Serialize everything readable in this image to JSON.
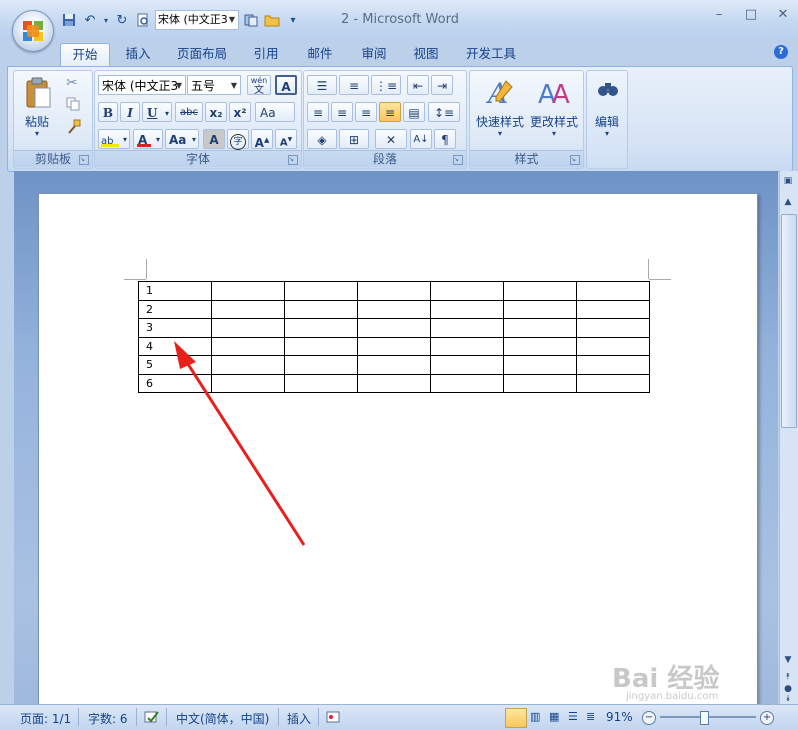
{
  "window": {
    "title": "2 - Microsoft Word",
    "controls": {
      "minimize": "–",
      "maximize": "□",
      "close": "✕"
    }
  },
  "quick_access": {
    "font_value": "宋体 (中文正3",
    "icons": [
      "save-icon",
      "undo-icon",
      "redo-icon",
      "print-preview-icon",
      "font-combo",
      "document-map-icon",
      "open-folder-icon",
      "customize-qat-icon"
    ]
  },
  "tabs": [
    {
      "label": "开始",
      "active": true
    },
    {
      "label": "插入",
      "active": false
    },
    {
      "label": "页面布局",
      "active": false
    },
    {
      "label": "引用",
      "active": false
    },
    {
      "label": "邮件",
      "active": false
    },
    {
      "label": "审阅",
      "active": false
    },
    {
      "label": "视图",
      "active": false
    },
    {
      "label": "开发工具",
      "active": false
    }
  ],
  "ribbon": {
    "clipboard": {
      "label": "剪贴板",
      "paste_label": "粘贴"
    },
    "font": {
      "label": "字体",
      "font_name": "宋体 (中文正3",
      "font_size": "五号",
      "bold": "B",
      "italic": "I",
      "underline": "U",
      "strike": "abc",
      "subscript": "x₂",
      "superscript": "x²",
      "grow": "A",
      "shrink": "A",
      "clear_format": "Aa",
      "char_border": "A",
      "phonetic": "wén",
      "enclosed": "字"
    },
    "paragraph": {
      "label": "段落"
    },
    "styles": {
      "label": "样式",
      "quick_styles": "快速样式",
      "change_styles": "更改样式"
    },
    "editing": {
      "label": "编辑",
      "edit": "编辑"
    }
  },
  "document": {
    "table": [
      [
        "1",
        "",
        "",
        "",
        "",
        "",
        ""
      ],
      [
        "2",
        "",
        "",
        "",
        "",
        "",
        ""
      ],
      [
        "3",
        "",
        "",
        "",
        "",
        "",
        ""
      ],
      [
        "4",
        "",
        "",
        "",
        "",
        "",
        ""
      ],
      [
        "5",
        "",
        "",
        "",
        "",
        "",
        ""
      ],
      [
        "6",
        "",
        "",
        "",
        "",
        "",
        ""
      ]
    ],
    "annotation_color": "#e8201b"
  },
  "status_bar": {
    "page": "页面: 1/1",
    "words": "字数: 6",
    "language": "中文(简体，中国)",
    "mode": "插入",
    "zoom": "91%"
  },
  "watermark": {
    "text": "Bai 经验",
    "sub": "jingyan.baidu.com"
  },
  "colors": {
    "ribbon_text": "#15428b",
    "accent": "#2b6bd8",
    "highlight": "#f8c65a",
    "font_color_bar": "#e02020",
    "highlight_bar": "#f2e800"
  }
}
